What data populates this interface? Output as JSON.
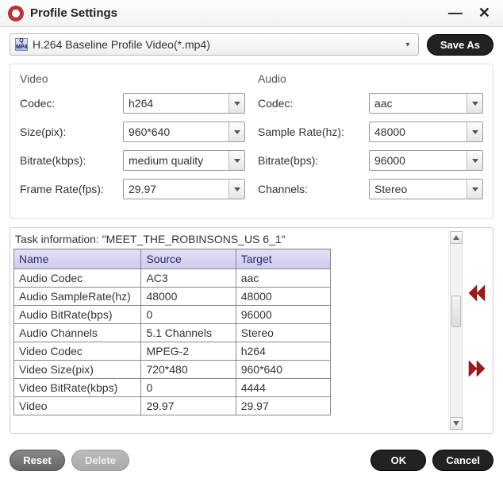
{
  "window": {
    "title": "Profile Settings"
  },
  "topbar": {
    "profile_label": "H.264 Baseline Profile Video(*.mp4)",
    "save_as": "Save As"
  },
  "video": {
    "heading": "Video",
    "codec_label": "Codec:",
    "codec_value": "h264",
    "size_label": "Size(pix):",
    "size_value": "960*640",
    "bitrate_label": "Bitrate(kbps):",
    "bitrate_value": "medium quality",
    "framerate_label": "Frame Rate(fps):",
    "framerate_value": "29.97"
  },
  "audio": {
    "heading": "Audio",
    "codec_label": "Codec:",
    "codec_value": "aac",
    "samplerate_label": "Sample Rate(hz):",
    "samplerate_value": "48000",
    "bitrate_label": "Bitrate(bps):",
    "bitrate_value": "96000",
    "channels_label": "Channels:",
    "channels_value": "Stereo"
  },
  "task": {
    "info": "Task information: \"MEET_THE_ROBINSONS_US 6_1\"",
    "headers": {
      "name": "Name",
      "source": "Source",
      "target": "Target"
    },
    "rows": [
      {
        "name": "Audio Codec",
        "source": "AC3",
        "target": "aac"
      },
      {
        "name": "Audio SampleRate(hz)",
        "source": "48000",
        "target": "48000"
      },
      {
        "name": "Audio BitRate(bps)",
        "source": "0",
        "target": "96000"
      },
      {
        "name": "Audio Channels",
        "source": "5.1 Channels",
        "target": "Stereo"
      },
      {
        "name": "Video Codec",
        "source": "MPEG-2",
        "target": "h264"
      },
      {
        "name": "Video Size(pix)",
        "source": "720*480",
        "target": "960*640"
      },
      {
        "name": "Video BitRate(kbps)",
        "source": "0",
        "target": "4444"
      },
      {
        "name": "Video",
        "source": "29.97",
        "target": "29.97"
      }
    ]
  },
  "footer": {
    "reset": "Reset",
    "delete": "Delete",
    "ok": "OK",
    "cancel": "Cancel"
  }
}
